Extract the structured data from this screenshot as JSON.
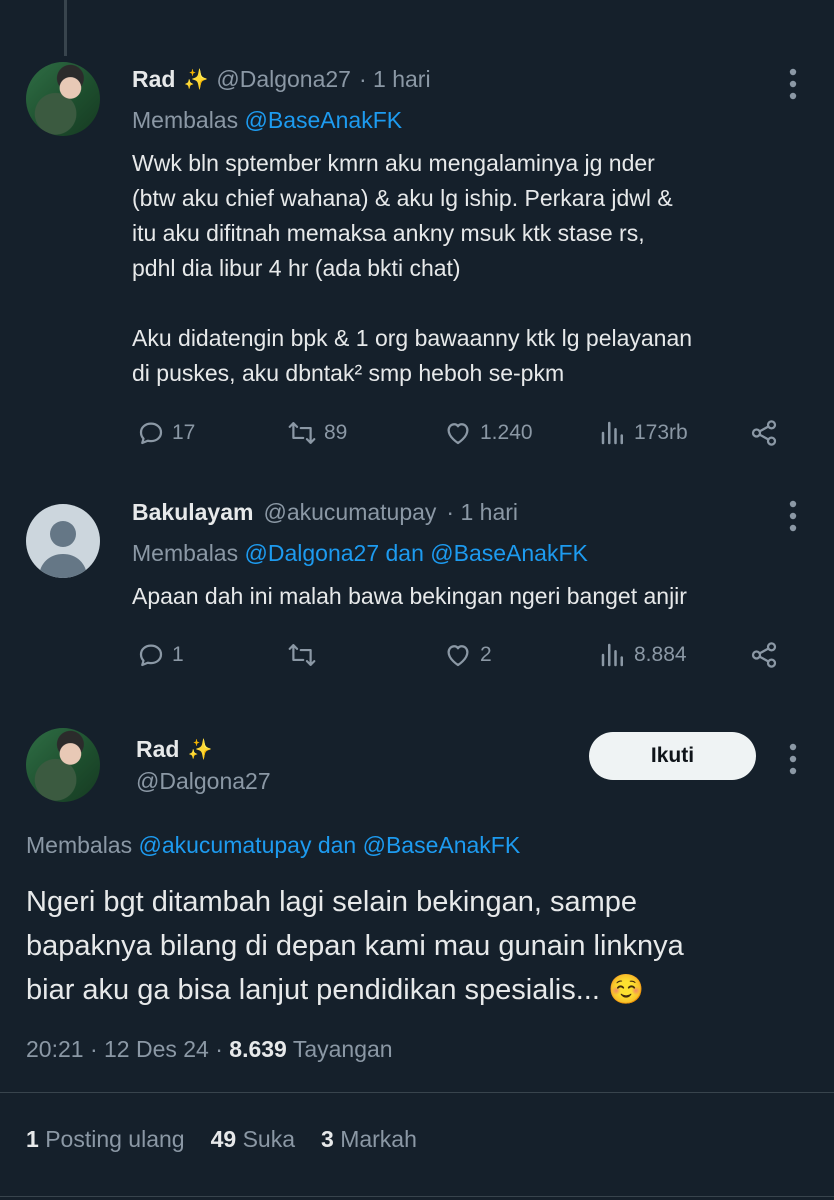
{
  "tweet1": {
    "name": "Rad",
    "handle": "@Dalgona27",
    "time": "· 1 hari",
    "replying_label": "Membalas",
    "replying_to": "@BaseAnakFK",
    "text": "Wwk bln sptember kmrn aku mengalaminya jg nder\n(btw aku chief wahana) & aku lg iship. Perkara jdwl &\nitu aku difitnah memaksa ankny msuk ktk stase rs,\npdhl dia libur 4 hr (ada bkti chat)\n\nAku didatengin bpk & 1 org bawaanny ktk lg pelayanan\ndi puskes, aku dbntak² smp heboh se-pkm",
    "replies": "17",
    "reposts": "89",
    "likes": "1.240",
    "views": "173rb"
  },
  "tweet2": {
    "name": "Bakulayam",
    "handle": "@akucumatupay",
    "time": "· 1 hari",
    "replying_label": "Membalas",
    "replying_to": "@Dalgona27 dan @BaseAnakFK",
    "text": "Apaan dah ini malah bawa bekingan ngeri banget anjir",
    "replies": "1",
    "reposts": "",
    "likes": "2",
    "views": "8.884"
  },
  "main_tweet": {
    "name": "Rad",
    "handle": "@Dalgona27",
    "follow_label": "Ikuti",
    "replying_label": "Membalas",
    "replying_to": "@akucumatupay dan @BaseAnakFK",
    "text": "Ngeri bgt ditambah lagi selain bekingan, sampe\nbapaknya bilang di depan kami mau gunain linknya\nbiar aku ga bisa lanjut pendidikan spesialis... ☺️",
    "time": "20:21 · 12 Des 24 ·",
    "views_count": "8.639",
    "views_label": "Tayangan",
    "reposts_count": "1",
    "reposts_label": "Posting ulang",
    "likes_count": "49",
    "likes_label": "Suka",
    "bookmarks_count": "3",
    "bookmarks_label": "Markah"
  },
  "icons": {
    "sparkle": "✨",
    "more": "more-icon",
    "reply": "reply-icon",
    "repost": "repost-icon",
    "like": "heart-icon",
    "views": "views-icon",
    "share": "share-icon"
  },
  "colors": {
    "background": "#15202b",
    "text": "#e7e9ea",
    "muted": "#8b98a5",
    "link": "#1d9bf0",
    "button": "#eff3f4"
  }
}
